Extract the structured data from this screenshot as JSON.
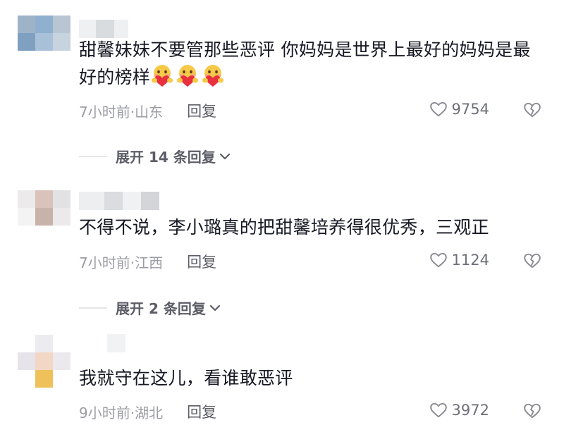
{
  "comments": [
    {
      "text": "甜馨妹妹不要管那些恶评 你妈妈是世界上最好的妈妈是最好的榜样",
      "time_location": "7小时前·山东",
      "reply_label": "回复",
      "likes": "9754",
      "emoji_count": 3,
      "expand_label": "展开 14 条回复"
    },
    {
      "text": "不得不说，李小璐真的把甜馨培养得很优秀，三观正",
      "time_location": "7小时前·江西",
      "reply_label": "回复",
      "likes": "1124",
      "expand_label": "展开 2 条回复"
    },
    {
      "text": "我就守在这儿，看谁敢恶评",
      "time_location": "9小时前·湖北",
      "reply_label": "回复",
      "likes": "3972"
    }
  ],
  "icons": {
    "like": "heart-outline-icon",
    "dislike": "broken-heart-icon",
    "expand": "chevron-down-icon"
  },
  "colors": {
    "text": "#161823",
    "meta": "#9b9ca3",
    "reply": "#5c5d66"
  }
}
